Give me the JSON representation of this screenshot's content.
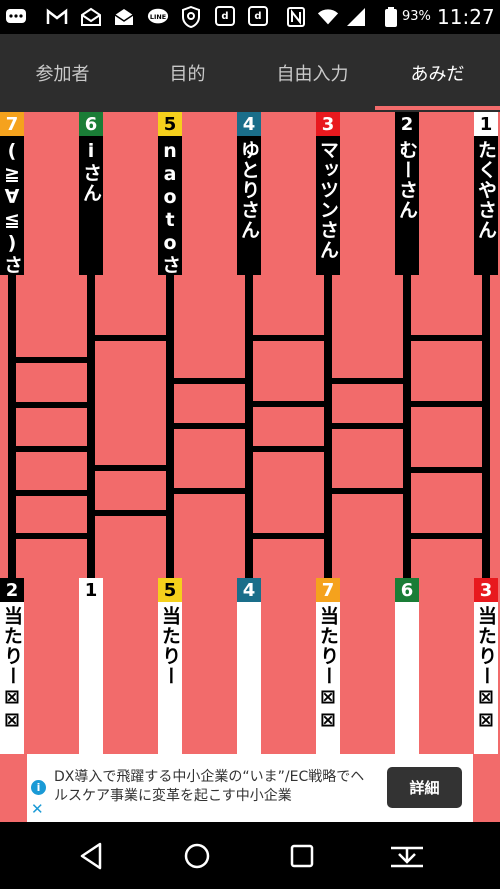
{
  "status_bar": {
    "battery_percent": "93%",
    "time": "11:27",
    "icons": [
      "chat-bubble-icon",
      "gmail-icon",
      "mail-icon",
      "mail-alt-icon",
      "line-app-icon",
      "shield-icon",
      "d-app-icon",
      "d-app-icon",
      "nfc-icon",
      "wifi-icon",
      "signal-icon",
      "battery-icon"
    ]
  },
  "tabs": [
    {
      "label": "参加者",
      "active": false
    },
    {
      "label": "目的",
      "active": false
    },
    {
      "label": "自由入力",
      "active": false
    },
    {
      "label": "あみだ",
      "active": true
    }
  ],
  "colors": {
    "board_bg": "#f26b6b",
    "line": "#000000",
    "badge_orange": "#f5a21d",
    "badge_green": "#1a7d36",
    "badge_yellow": "#f5d01c",
    "badge_teal": "#1a6e8a",
    "badge_red": "#e8191e",
    "badge_black": "#000000",
    "badge_white": "#ffffff"
  },
  "participants": [
    {
      "number": "7",
      "name": "(≧∀≦)さ",
      "badge_color": "#f5a21d"
    },
    {
      "number": "6",
      "name": "iさん",
      "badge_color": "#1a7d36"
    },
    {
      "number": "5",
      "name": "naotoさ",
      "badge_color": "#f5d01c"
    },
    {
      "number": "4",
      "name": "ゆとりさん",
      "badge_color": "#1a6e8a"
    },
    {
      "number": "3",
      "name": "マッツンさん",
      "badge_color": "#e8191e"
    },
    {
      "number": "2",
      "name": "むーさん",
      "badge_color": "#000000"
    },
    {
      "number": "1",
      "name": "たくやさん",
      "badge_color": "#ffffff"
    }
  ],
  "results": [
    {
      "number": "2",
      "text": "当たりー⊠⊠",
      "badge_color": "#000000",
      "highlight": true
    },
    {
      "number": "1",
      "text": "",
      "badge_color": "#ffffff",
      "highlight": false
    },
    {
      "number": "5",
      "text": "当たりー",
      "badge_color": "#f5d01c",
      "highlight": true
    },
    {
      "number": "4",
      "text": "",
      "badge_color": "#1a6e8a",
      "highlight": false
    },
    {
      "number": "7",
      "text": "当たりー⊠⊠",
      "badge_color": "#f5a21d",
      "highlight": true
    },
    {
      "number": "6",
      "text": "",
      "badge_color": "#1a7d36",
      "highlight": false
    },
    {
      "number": "3",
      "text": "当たりー⊠⊠",
      "badge_color": "#e8191e",
      "highlight": true
    }
  ],
  "ad": {
    "text": "DX導入で飛躍する中小企業の“いま”/EC戦略でヘルスケア事業に変革を起こす中小企業",
    "button_label": "詳細",
    "info_icon": "info-icon",
    "close_icon": "close-icon"
  },
  "nav": [
    "back-icon",
    "home-icon",
    "recents-icon",
    "download-icon"
  ]
}
